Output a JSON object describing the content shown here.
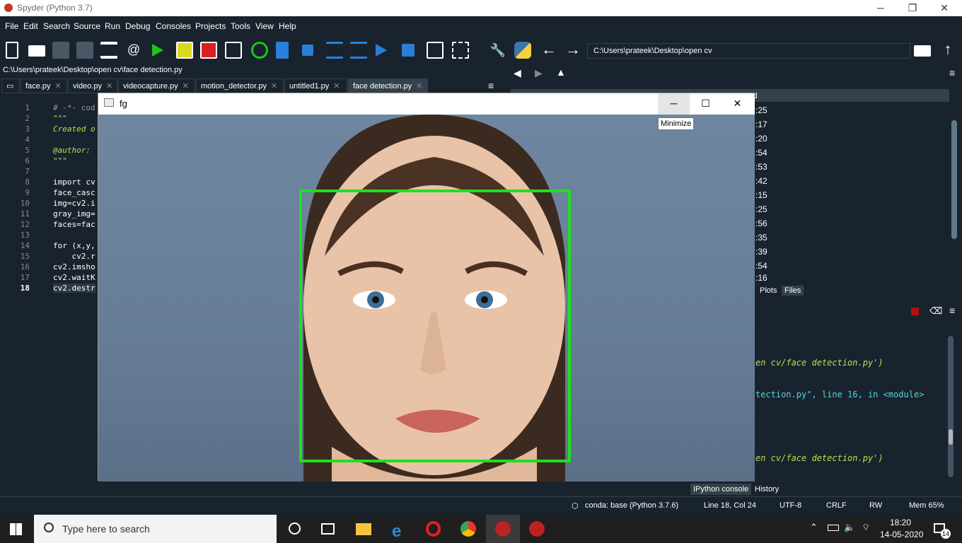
{
  "window": {
    "title": "Spyder (Python 3.7)",
    "minimize": "─",
    "maximize": "❐",
    "close": "✕"
  },
  "menu": [
    "File",
    "Edit",
    "Search",
    "Source",
    "Run",
    "Debug",
    "Consoles",
    "Projects",
    "Tools",
    "View",
    "Help"
  ],
  "toolbar": {
    "working_dir": "C:\\Users\\prateek\\Desktop\\open cv"
  },
  "editor": {
    "file_path": "C:\\Users\\prateek\\Desktop\\open cv\\face detection.py",
    "tabs": [
      {
        "label": "face.py"
      },
      {
        "label": "video.py"
      },
      {
        "label": "videocapture.py"
      },
      {
        "label": "motion_detector.py"
      },
      {
        "label": "untitled1.py"
      },
      {
        "label": "face detection.py",
        "active": true
      }
    ],
    "lines": [
      {
        "n": "1",
        "text": "# -*- cod"
      },
      {
        "n": "2",
        "text": "\"\"\""
      },
      {
        "n": "3",
        "text": "Created o"
      },
      {
        "n": "4",
        "text": ""
      },
      {
        "n": "5",
        "text": "@author: "
      },
      {
        "n": "6",
        "text": "\"\"\""
      },
      {
        "n": "7",
        "text": ""
      },
      {
        "n": "8",
        "text": "import cv"
      },
      {
        "n": "9",
        "text": "face_casc"
      },
      {
        "n": "10",
        "text": "img=cv2.i"
      },
      {
        "n": "11",
        "text": "gray_img="
      },
      {
        "n": "12",
        "text": "faces=fac"
      },
      {
        "n": "13",
        "text": ""
      },
      {
        "n": "14",
        "text": "for (x,y,"
      },
      {
        "n": "15",
        "text": "    cv2.r"
      },
      {
        "n": "16",
        "text": "cv2.imsho"
      },
      {
        "n": "17",
        "text": "cv2.waitK"
      },
      {
        "n": "18",
        "text": "cv2.destr"
      }
    ]
  },
  "files_pane": {
    "header": "d",
    "times": [
      ":25",
      ":17",
      ":20",
      ":54",
      ":53",
      ":42",
      ":15",
      ":25",
      ":56",
      ":35",
      ":39",
      ":54",
      ":16"
    ],
    "tabs": [
      "Plots",
      "Files"
    ]
  },
  "console": {
    "lines": [
      {
        "text": "en cv/face detection.py')"
      },
      {
        "text": "tection.py\", line 16, in <module>"
      },
      {
        "text": "en cv/face detection.py')"
      }
    ],
    "tabs": [
      "IPython console",
      "History"
    ]
  },
  "statusbar": {
    "conda": "conda: base (Python 3.7.6)",
    "position": "Line 18, Col 24",
    "encoding": "UTF-8",
    "eol": "CRLF",
    "rw": "RW",
    "mem": "Mem 65%"
  },
  "fg_window": {
    "title": "fg",
    "tooltip": "Minimize"
  },
  "taskbar": {
    "search_placeholder": "Type here to search",
    "time": "18:20",
    "date": "14-05-2020",
    "notifications": "14"
  }
}
